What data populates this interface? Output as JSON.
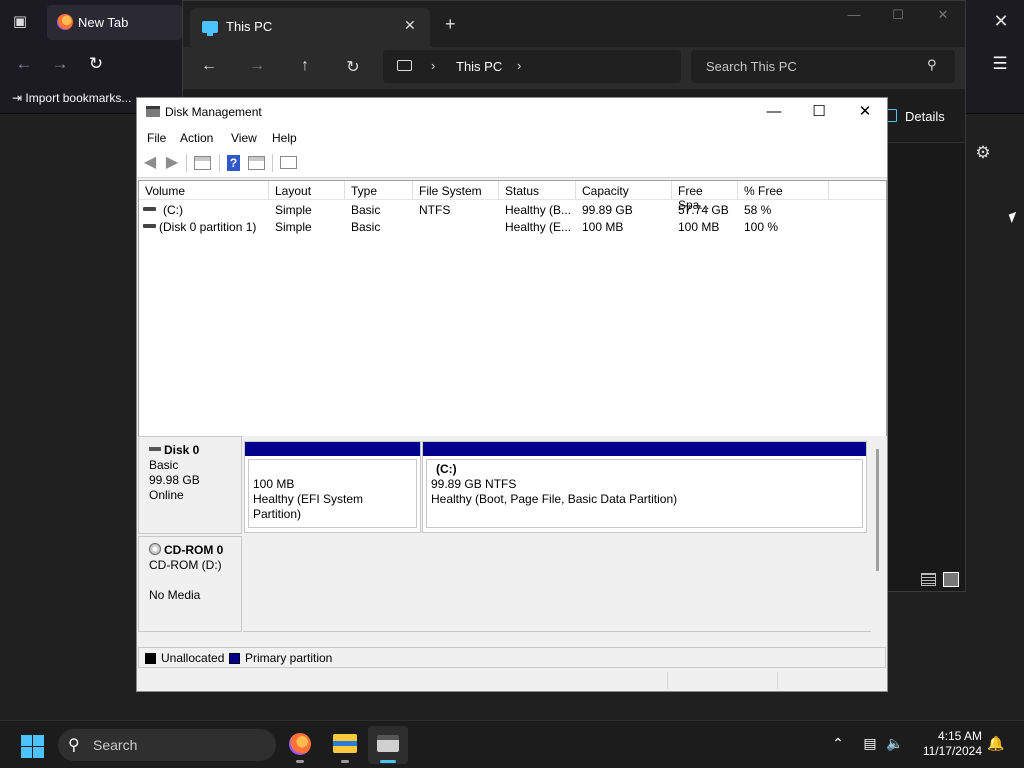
{
  "firefox": {
    "tab_title": "New Tab",
    "import_bookmarks": "Import bookmarks..."
  },
  "explorer": {
    "tab_title": "This PC",
    "address": "This PC",
    "search_placeholder": "Search This PC",
    "details_label": "Details"
  },
  "disk_mgmt": {
    "title": "Disk Management",
    "menu": [
      "File",
      "Action",
      "View",
      "Help"
    ],
    "columns": [
      "Volume",
      "Layout",
      "Type",
      "File System",
      "Status",
      "Capacity",
      "Free Spa...",
      "% Free"
    ],
    "volumes": [
      {
        "volume": "(C:)",
        "layout": "Simple",
        "type": "Basic",
        "fs": "NTFS",
        "status": "Healthy (B...",
        "capacity": "99.89 GB",
        "free": "57.74 GB",
        "pct": "58 %"
      },
      {
        "volume": "(Disk 0 partition 1)",
        "layout": "Simple",
        "type": "Basic",
        "fs": "",
        "status": "Healthy (E...",
        "capacity": "100 MB",
        "free": "100 MB",
        "pct": "100 %"
      }
    ],
    "disks": [
      {
        "name": "Disk 0",
        "type": "Basic",
        "size": "99.98 GB",
        "state": "Online",
        "partitions": [
          {
            "label": "",
            "size": "100 MB",
            "status": "Healthy (EFI System Partition)"
          },
          {
            "label": "(C:)",
            "size": "99.89 GB NTFS",
            "status": "Healthy (Boot, Page File, Basic Data Partition)"
          }
        ]
      },
      {
        "name": "CD-ROM 0",
        "type": "CD-ROM (D:)",
        "state": "No Media"
      }
    ],
    "legend": [
      {
        "label": "Unallocated",
        "color": "#000000"
      },
      {
        "label": "Primary partition",
        "color": "#00008b"
      }
    ]
  },
  "taskbar": {
    "search_placeholder": "Search",
    "time": "4:15 AM",
    "date": "11/17/2024"
  }
}
